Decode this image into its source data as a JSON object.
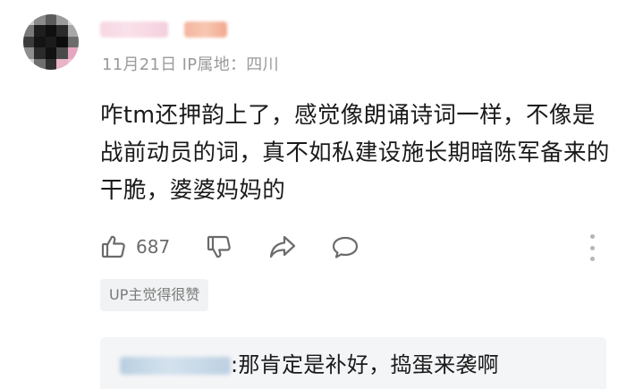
{
  "comment": {
    "meta": "11月21日 IP属地：四川",
    "text": "咋tm还押韵上了，感觉像朗诵诗词一样，不像是战前动员的词，真不如私建设施长期暗陈军备来的干脆，婆婆妈妈的",
    "like_count": "687",
    "up_badge": "UP主觉得很赞"
  },
  "reply": {
    "text": ":那肯定是补好，捣蛋来袭啊"
  },
  "icons": {
    "like": "thumbs-up-icon",
    "dislike": "thumbs-down-icon",
    "share": "share-icon",
    "reply": "reply-bubble-icon",
    "more": "more-vertical-icon"
  },
  "colors": {
    "text": "#1a1a1a",
    "meta": "#9a9a9a",
    "badge_bg": "#f1f2f3",
    "reply_bg": "#f4f5f7"
  }
}
